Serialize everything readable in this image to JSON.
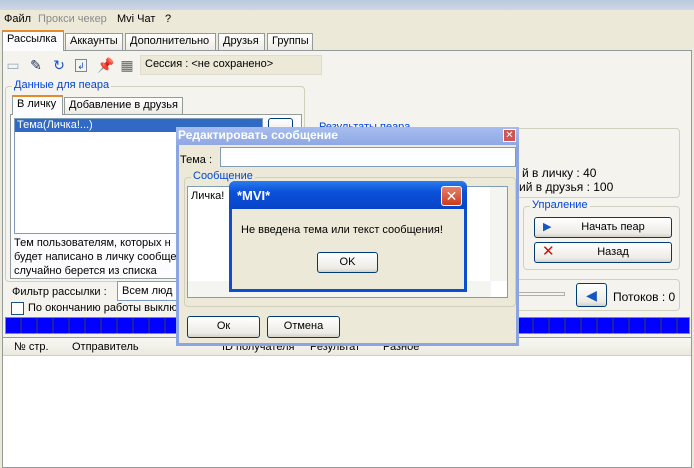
{
  "menu": [
    "Файл",
    "Прокси чекер",
    "Mvi Чат",
    "?"
  ],
  "tabs": [
    "Рассылка",
    "Аккаунты",
    "Дополнительно",
    "Друзья",
    "Группы"
  ],
  "toolbar": {
    "icons": [
      "note-icon",
      "pencil-icon",
      "refresh-icon",
      "import-icon",
      "pin-icon",
      "settings-icon"
    ],
    "session": "Сессия : <не сохранено>"
  },
  "pr_group": {
    "label": "Данные для пеара",
    "tabs": [
      "В личку",
      "Добавление в друзья"
    ],
    "list_items": [
      "Тема(Личка!...)"
    ],
    "info": [
      "Тем пользователям, которых н",
      "будет написано в личку сообще",
      "случайно берется из списка"
    ]
  },
  "filter": {
    "label": "Фильтр рассылки :",
    "value": "Всем люд"
  },
  "checkbox": {
    "label": "По окончанию работы выклю",
    "checked": false
  },
  "results": {
    "label": "Результаты пеара",
    "line1": "й в личку : 40",
    "line2": "ий в друзья : 100"
  },
  "control": {
    "label": "Упраление",
    "start": "Начать пеар",
    "back": "Назад"
  },
  "threads": "Потоков : 0",
  "table": {
    "columns": [
      "№ стр.",
      "Отправитель",
      "ID получателя",
      "Результат",
      "Разное"
    ]
  },
  "edit_dialog": {
    "title": "Редактировать сообщение",
    "subject_label": "Тема :",
    "subject_value": "",
    "message_label": "Сообщение",
    "message": "Личка!",
    "ok": "Ок",
    "cancel": "Отмена"
  },
  "alert": {
    "title": "*MVI*",
    "message": "Не введена тема или текст сообщения!",
    "ok": "OK"
  },
  "colors": {
    "accent": "#0046d5",
    "progress": "#0000ff",
    "selection": "#316ac5"
  }
}
